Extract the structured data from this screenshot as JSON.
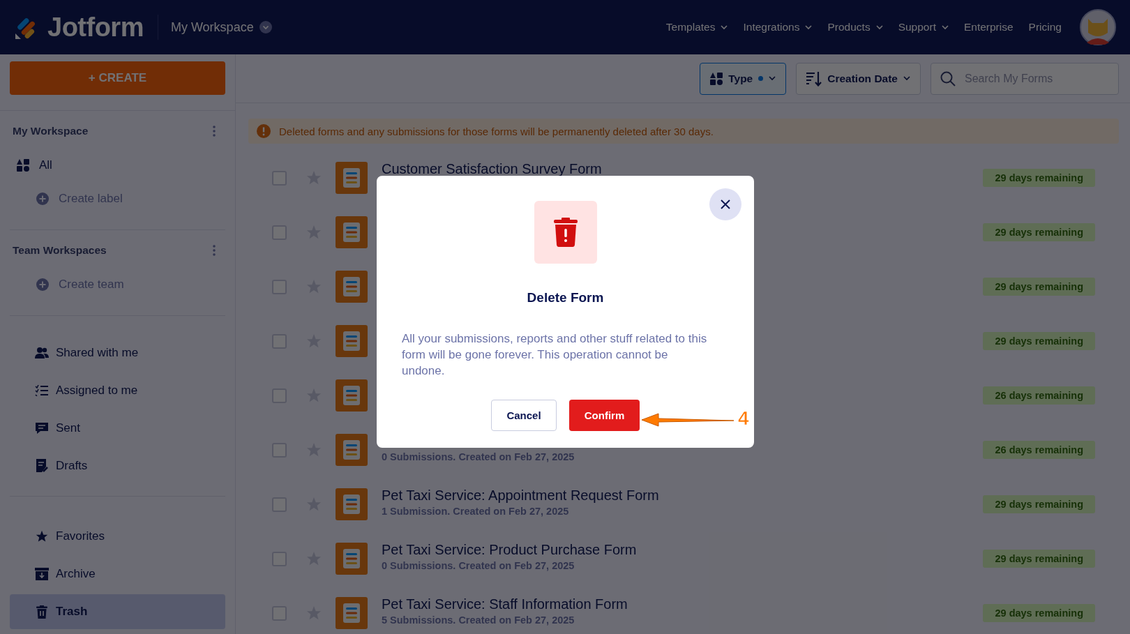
{
  "header": {
    "logo": "Jotform",
    "workspace": "My Workspace",
    "nav": [
      {
        "label": "Templates",
        "dropdown": true
      },
      {
        "label": "Integrations",
        "dropdown": true
      },
      {
        "label": "Products",
        "dropdown": true
      },
      {
        "label": "Support",
        "dropdown": true
      },
      {
        "label": "Enterprise",
        "dropdown": false
      },
      {
        "label": "Pricing",
        "dropdown": false
      }
    ]
  },
  "sidebar": {
    "create": "+ CREATE",
    "my_workspace": {
      "title": "My Workspace",
      "items": [
        {
          "label": "All",
          "kind": "all"
        },
        {
          "label": "Create label",
          "kind": "add"
        }
      ]
    },
    "team_workspaces": {
      "title": "Team Workspaces",
      "items": [
        {
          "label": "Create team",
          "kind": "add"
        }
      ]
    },
    "groups": [
      [
        {
          "label": "Shared with me",
          "kind": "shared",
          "selected": false
        },
        {
          "label": "Assigned to me",
          "kind": "assigned",
          "selected": false
        },
        {
          "label": "Sent",
          "kind": "sent",
          "selected": false
        },
        {
          "label": "Drafts",
          "kind": "drafts",
          "selected": false
        }
      ],
      [
        {
          "label": "Favorites",
          "kind": "favorites",
          "selected": false
        },
        {
          "label": "Archive",
          "kind": "archive",
          "selected": false
        },
        {
          "label": "Trash",
          "kind": "trash",
          "selected": true
        }
      ]
    ]
  },
  "toolbar": {
    "type_filter": {
      "label": "Type",
      "filtered": true
    },
    "sort": "Creation Date",
    "search": {
      "placeholder": "Search My Forms"
    }
  },
  "notice": "Deleted forms and any submissions for those forms will be permanently deleted after 30 days.",
  "forms": [
    {
      "title": "Customer Satisfaction Survey Form",
      "checked": false,
      "starred": false,
      "badge": "29 days remaining"
    },
    {
      "checked": false,
      "starred": false,
      "badge": "29 days remaining"
    },
    {
      "checked": false,
      "starred": false,
      "badge": "29 days remaining"
    },
    {
      "checked": false,
      "starred": false,
      "badge": "29 days remaining"
    },
    {
      "checked": false,
      "starred": false,
      "badge": "26 days remaining"
    },
    {
      "subtitle": "0 Submissions. Created on Feb 27, 2025",
      "checked": false,
      "starred": false,
      "badge": "26 days remaining"
    },
    {
      "title": "Pet Taxi Service: Appointment Request Form",
      "subtitle": "1 Submission. Created on Feb 27, 2025",
      "checked": false,
      "starred": false,
      "badge": "29 days remaining"
    },
    {
      "title": "Pet Taxi Service: Product Purchase Form",
      "subtitle": "0 Submissions. Created on Feb 27, 2025",
      "checked": false,
      "starred": false,
      "badge": "29 days remaining"
    },
    {
      "title": "Pet Taxi Service: Staff Information Form",
      "subtitle": "5 Submissions. Created on Feb 27, 2025",
      "checked": false,
      "starred": false,
      "badge": "29 days remaining"
    }
  ],
  "modal": {
    "title": "Delete Form",
    "message": "All your submissions, reports and other stuff related to this form will be gone forever. This operation cannot be undone.",
    "cancel": "Cancel",
    "confirm": "Confirm"
  },
  "annotation": {
    "label": "4"
  }
}
